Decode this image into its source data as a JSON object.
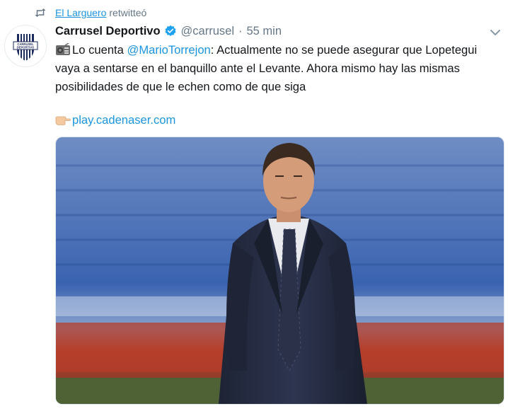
{
  "retweet": {
    "icon": "retweet-icon",
    "user": "El Larguero",
    "suffix": "retwitteó"
  },
  "author": {
    "avatar_icon": "carrusel-deportivo-logo",
    "avatar_text": "CARRUSEL DEPORTIVO",
    "display_name": "Carrusel Deportivo",
    "verified_icon": "verified-badge-icon",
    "handle": "@carrusel",
    "separator": "·",
    "time": "55 min"
  },
  "menu": {
    "icon": "chevron-down-icon"
  },
  "tweet": {
    "lead_icon": "radio-emoji-icon",
    "text_part1": "Lo cuenta ",
    "mention": "@MarioTorrejon",
    "text_part2": ": Actualmente no se puede asegurar que Lopetegui vaya a sentarse en el banquillo ante el Levante. Ahora mismo hay las mismas posibilidades de que le echen como de que siga",
    "link_icon": "pointing-hand-emoji-icon",
    "link": "play.cadenaser.com"
  },
  "media": {
    "icon": "photo-coach-in-stadium"
  },
  "colors": {
    "accent": "#1b95e0",
    "muted": "#657786",
    "text": "#14171a"
  }
}
